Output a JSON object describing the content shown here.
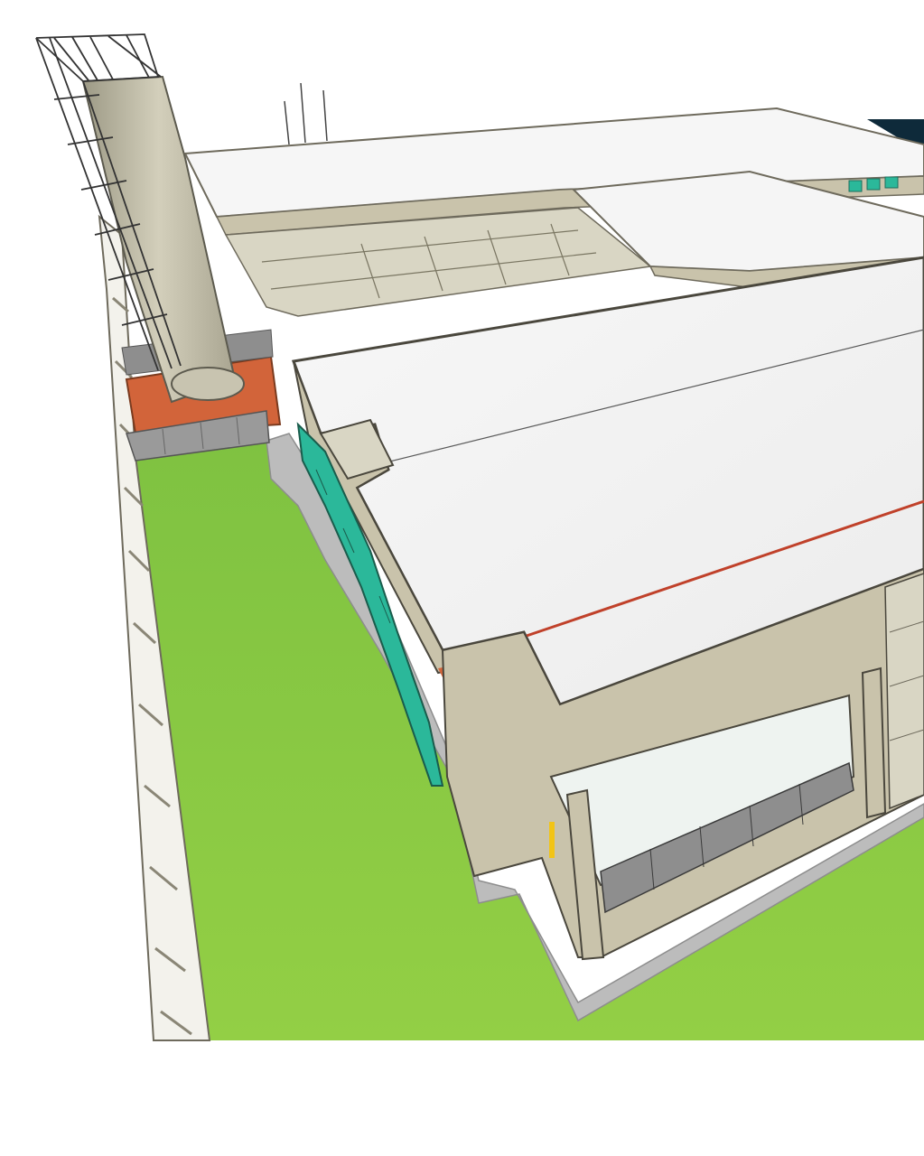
{
  "scene": {
    "subject": "3d-building-model",
    "colors": {
      "background": "#ffffff",
      "ground": "#8cc63f",
      "roof": "#f4f4f4",
      "wall": "#c9c3ab",
      "wall_dark": "#a39d86",
      "pavement": "#bdbdbd",
      "accent_orange": "#d2643a",
      "glazing": "#2bb89a",
      "panel": "#8e8e8e",
      "sky": "#0e2a3a"
    }
  }
}
